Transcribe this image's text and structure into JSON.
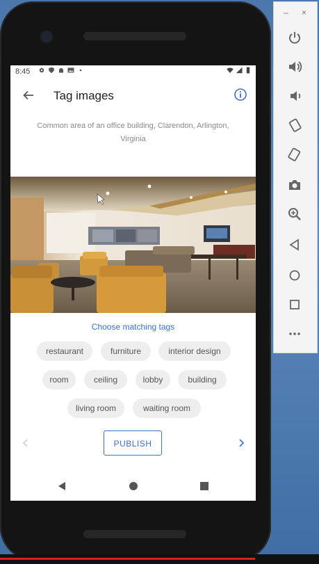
{
  "status_bar": {
    "time": "8:45"
  },
  "app_bar": {
    "title": "Tag images"
  },
  "image": {
    "description": "Common area of an office building, Clarendon, Arlington, Virginia"
  },
  "tags_section": {
    "heading": "Choose matching tags",
    "tags": [
      "restaurant",
      "furniture",
      "interior design",
      "room",
      "ceiling",
      "lobby",
      "building",
      "living room",
      "waiting room"
    ]
  },
  "actions": {
    "publish_label": "PUBLISH"
  },
  "emulator_panel": {
    "minimize": "–",
    "close": "×",
    "tools": [
      "power-icon",
      "volume-up-icon",
      "volume-down-icon",
      "rotate-left-icon",
      "rotate-right-icon",
      "camera-icon",
      "zoom-icon",
      "back-icon",
      "home-icon",
      "overview-icon",
      "more-icon"
    ]
  },
  "video_progress": 0.8,
  "colors": {
    "accent": "#3c6fd1",
    "chip_bg": "#eeeeee",
    "progress": "#e02020"
  }
}
